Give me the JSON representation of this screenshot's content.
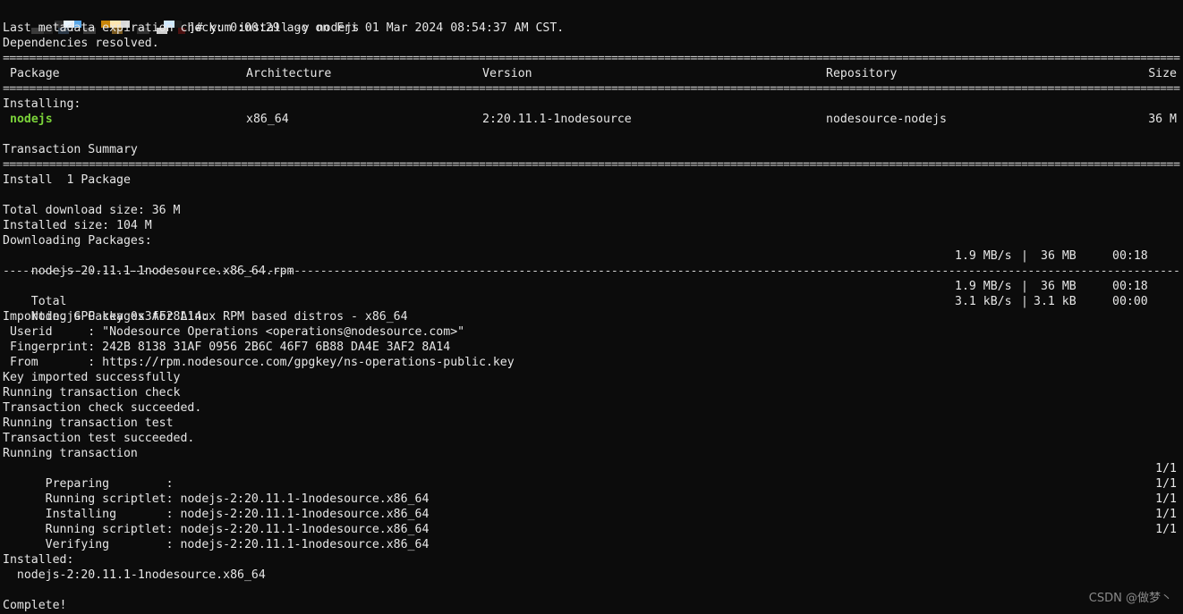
{
  "prompt": {
    "host_redacted": true,
    "command_suffix": "]# yum install -y nodejs"
  },
  "metadata_line": "Last metadata expiration check: 0:00:29 ago on Fri 01 Mar 2024 08:54:37 AM CST.",
  "deps_resolved": "Dependencies resolved.",
  "separator_double": "=====================================================================================================================================================================================================================",
  "separator_dash": "-----------------------------------------------------------------------------------------------------------------------------------------------------------------------------------------------------------------------",
  "table": {
    "headers": {
      "package": "Package",
      "architecture": "Architecture",
      "version": "Version",
      "repository": "Repository",
      "size": "Size"
    },
    "installing_label": "Installing:",
    "row": {
      "package": "nodejs",
      "architecture": "x86_64",
      "version": "2:20.11.1-1nodesource",
      "repository": "nodesource-nodejs",
      "size": "36 M"
    }
  },
  "transaction_summary": "Transaction Summary",
  "install_count": "Install  1 Package",
  "total_download": "Total download size: 36 M",
  "installed_size": "Installed size: 104 M",
  "downloading": "Downloading Packages:",
  "download_file": {
    "name": "nodejs-20.11.1-1nodesource.x86_64.rpm",
    "rate": "1.9 MB/s",
    "size": "36 MB",
    "time": "00:18"
  },
  "total_row": {
    "label": "Total",
    "rate": "1.9 MB/s",
    "size": "36 MB",
    "time": "00:18"
  },
  "repo_row": {
    "label": "Node.js Packages for Linux RPM based distros - x86_64",
    "rate": "3.1 kB/s",
    "size": "3.1 kB",
    "time": "00:00"
  },
  "gpg": {
    "importing": "Importing GPG key 0x3AF28A14:",
    "userid": " Userid     : \"Nodesource Operations <operations@nodesource.com>\"",
    "fingerprint": " Fingerprint: 242B 8138 31AF 0956 2B6C 46F7 6B88 DA4E 3AF2 8A14",
    "from": " From       : https://rpm.nodesource.com/gpgkey/ns-operations-public.key",
    "imported": "Key imported successfully"
  },
  "steps": [
    "Running transaction check",
    "Transaction check succeeded.",
    "Running transaction test",
    "Transaction test succeeded.",
    "Running transaction"
  ],
  "progress": [
    {
      "text": "  Preparing        :",
      "count": "1/1"
    },
    {
      "text": "  Running scriptlet: nodejs-2:20.11.1-1nodesource.x86_64",
      "count": "1/1"
    },
    {
      "text": "  Installing       : nodejs-2:20.11.1-1nodesource.x86_64",
      "count": "1/1"
    },
    {
      "text": "  Running scriptlet: nodejs-2:20.11.1-1nodesource.x86_64",
      "count": "1/1"
    },
    {
      "text": "  Verifying        : nodejs-2:20.11.1-1nodesource.x86_64",
      "count": "1/1"
    }
  ],
  "installed_label": "Installed:",
  "installed_pkg": "  nodejs-2:20.11.1-1nodesource.x86_64",
  "complete": "Complete!",
  "watermark": "CSDN @做梦丶",
  "colors": {
    "background": "#0c0c0c",
    "text": "#e6e6e6",
    "package_highlight": "#7bd33a"
  }
}
